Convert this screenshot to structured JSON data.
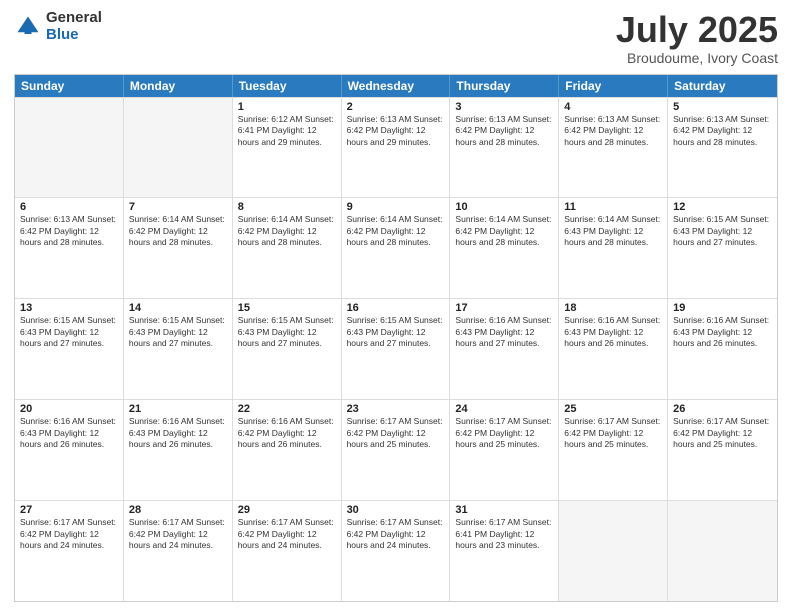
{
  "logo": {
    "general": "General",
    "blue": "Blue"
  },
  "header": {
    "month": "July 2025",
    "location": "Broudoume, Ivory Coast"
  },
  "weekdays": [
    "Sunday",
    "Monday",
    "Tuesday",
    "Wednesday",
    "Thursday",
    "Friday",
    "Saturday"
  ],
  "weeks": [
    [
      {
        "day": "",
        "info": "",
        "empty": true
      },
      {
        "day": "",
        "info": "",
        "empty": true
      },
      {
        "day": "1",
        "info": "Sunrise: 6:12 AM\nSunset: 6:41 PM\nDaylight: 12 hours and 29 minutes."
      },
      {
        "day": "2",
        "info": "Sunrise: 6:13 AM\nSunset: 6:42 PM\nDaylight: 12 hours and 29 minutes."
      },
      {
        "day": "3",
        "info": "Sunrise: 6:13 AM\nSunset: 6:42 PM\nDaylight: 12 hours and 28 minutes."
      },
      {
        "day": "4",
        "info": "Sunrise: 6:13 AM\nSunset: 6:42 PM\nDaylight: 12 hours and 28 minutes."
      },
      {
        "day": "5",
        "info": "Sunrise: 6:13 AM\nSunset: 6:42 PM\nDaylight: 12 hours and 28 minutes."
      }
    ],
    [
      {
        "day": "6",
        "info": "Sunrise: 6:13 AM\nSunset: 6:42 PM\nDaylight: 12 hours and 28 minutes."
      },
      {
        "day": "7",
        "info": "Sunrise: 6:14 AM\nSunset: 6:42 PM\nDaylight: 12 hours and 28 minutes."
      },
      {
        "day": "8",
        "info": "Sunrise: 6:14 AM\nSunset: 6:42 PM\nDaylight: 12 hours and 28 minutes."
      },
      {
        "day": "9",
        "info": "Sunrise: 6:14 AM\nSunset: 6:42 PM\nDaylight: 12 hours and 28 minutes."
      },
      {
        "day": "10",
        "info": "Sunrise: 6:14 AM\nSunset: 6:42 PM\nDaylight: 12 hours and 28 minutes."
      },
      {
        "day": "11",
        "info": "Sunrise: 6:14 AM\nSunset: 6:43 PM\nDaylight: 12 hours and 28 minutes."
      },
      {
        "day": "12",
        "info": "Sunrise: 6:15 AM\nSunset: 6:43 PM\nDaylight: 12 hours and 27 minutes."
      }
    ],
    [
      {
        "day": "13",
        "info": "Sunrise: 6:15 AM\nSunset: 6:43 PM\nDaylight: 12 hours and 27 minutes."
      },
      {
        "day": "14",
        "info": "Sunrise: 6:15 AM\nSunset: 6:43 PM\nDaylight: 12 hours and 27 minutes."
      },
      {
        "day": "15",
        "info": "Sunrise: 6:15 AM\nSunset: 6:43 PM\nDaylight: 12 hours and 27 minutes."
      },
      {
        "day": "16",
        "info": "Sunrise: 6:15 AM\nSunset: 6:43 PM\nDaylight: 12 hours and 27 minutes."
      },
      {
        "day": "17",
        "info": "Sunrise: 6:16 AM\nSunset: 6:43 PM\nDaylight: 12 hours and 27 minutes."
      },
      {
        "day": "18",
        "info": "Sunrise: 6:16 AM\nSunset: 6:43 PM\nDaylight: 12 hours and 26 minutes."
      },
      {
        "day": "19",
        "info": "Sunrise: 6:16 AM\nSunset: 6:43 PM\nDaylight: 12 hours and 26 minutes."
      }
    ],
    [
      {
        "day": "20",
        "info": "Sunrise: 6:16 AM\nSunset: 6:43 PM\nDaylight: 12 hours and 26 minutes."
      },
      {
        "day": "21",
        "info": "Sunrise: 6:16 AM\nSunset: 6:43 PM\nDaylight: 12 hours and 26 minutes."
      },
      {
        "day": "22",
        "info": "Sunrise: 6:16 AM\nSunset: 6:42 PM\nDaylight: 12 hours and 26 minutes."
      },
      {
        "day": "23",
        "info": "Sunrise: 6:17 AM\nSunset: 6:42 PM\nDaylight: 12 hours and 25 minutes."
      },
      {
        "day": "24",
        "info": "Sunrise: 6:17 AM\nSunset: 6:42 PM\nDaylight: 12 hours and 25 minutes."
      },
      {
        "day": "25",
        "info": "Sunrise: 6:17 AM\nSunset: 6:42 PM\nDaylight: 12 hours and 25 minutes."
      },
      {
        "day": "26",
        "info": "Sunrise: 6:17 AM\nSunset: 6:42 PM\nDaylight: 12 hours and 25 minutes."
      }
    ],
    [
      {
        "day": "27",
        "info": "Sunrise: 6:17 AM\nSunset: 6:42 PM\nDaylight: 12 hours and 24 minutes."
      },
      {
        "day": "28",
        "info": "Sunrise: 6:17 AM\nSunset: 6:42 PM\nDaylight: 12 hours and 24 minutes."
      },
      {
        "day": "29",
        "info": "Sunrise: 6:17 AM\nSunset: 6:42 PM\nDaylight: 12 hours and 24 minutes."
      },
      {
        "day": "30",
        "info": "Sunrise: 6:17 AM\nSunset: 6:42 PM\nDaylight: 12 hours and 24 minutes."
      },
      {
        "day": "31",
        "info": "Sunrise: 6:17 AM\nSunset: 6:41 PM\nDaylight: 12 hours and 23 minutes."
      },
      {
        "day": "",
        "info": "",
        "empty": true
      },
      {
        "day": "",
        "info": "",
        "empty": true
      }
    ]
  ]
}
